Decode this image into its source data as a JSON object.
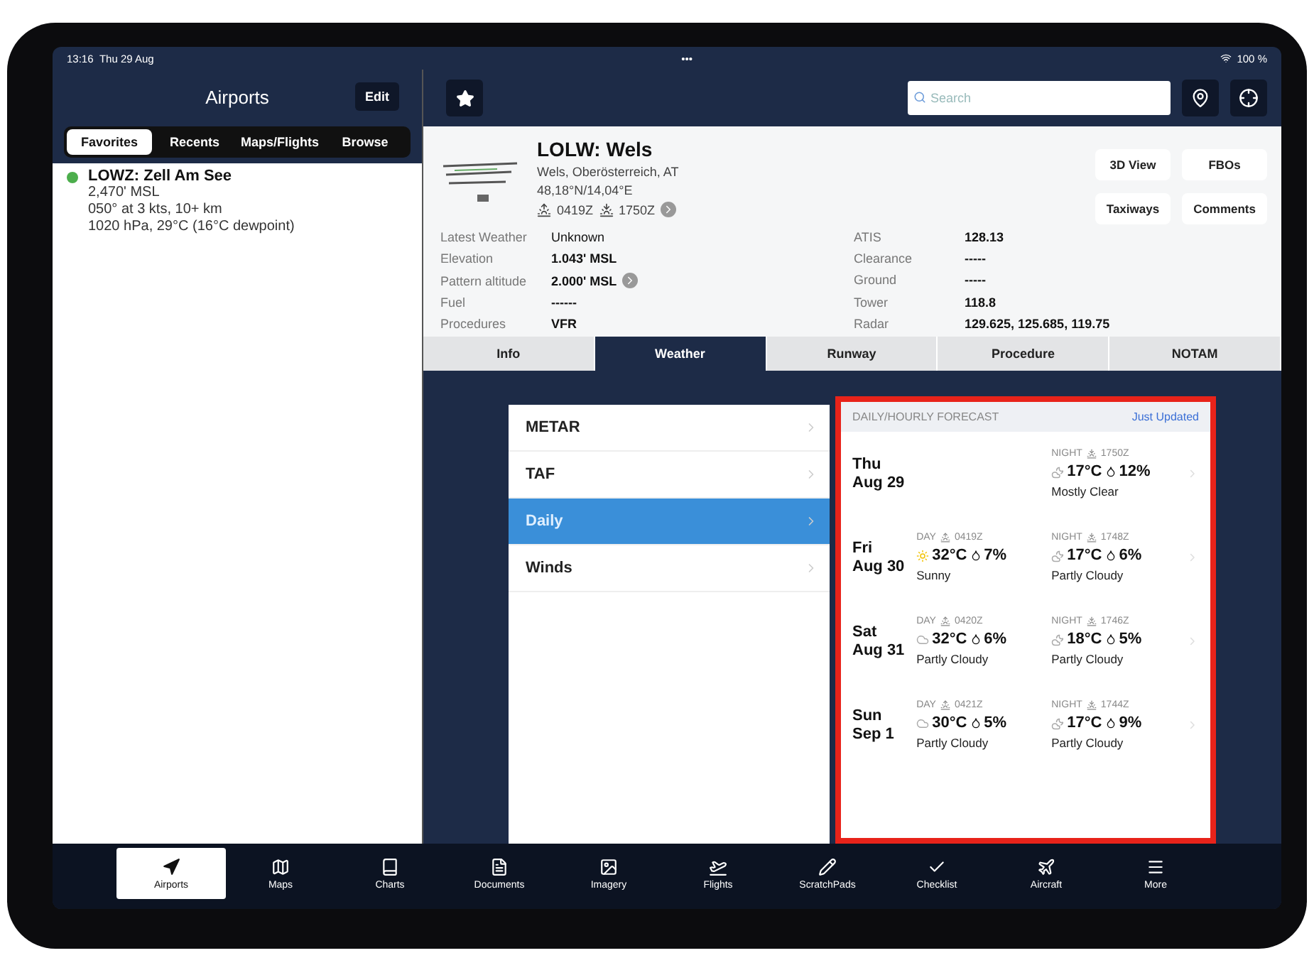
{
  "status_bar": {
    "time": "13:16",
    "date": "Thu 29 Aug",
    "dots": "•••",
    "battery": "100 %"
  },
  "sidebar": {
    "title": "Airports",
    "edit": "Edit",
    "segments": [
      {
        "label": "Favorites",
        "selected": true
      },
      {
        "label": "Recents",
        "selected": false
      },
      {
        "label": "Maps/Flights",
        "selected": false
      },
      {
        "label": "Browse",
        "selected": false
      }
    ],
    "items": [
      {
        "name": "LOWZ: Zell Am See",
        "color": "#4cae4c",
        "lines": [
          "2,470' MSL",
          "050° at 3 kts, 10+ km",
          "1020 hPa, 29°C (16°C dewpoint)"
        ]
      }
    ]
  },
  "toolbar": {
    "search": {
      "placeholder": "Search"
    }
  },
  "airport": {
    "title": "LOLW: Wels",
    "region": "Wels, Oberösterreich, AT",
    "coords": "48,18°N/14,04°E",
    "sunrise": "0419Z",
    "sunset": "1750Z",
    "buttons": [
      "3D View",
      "FBOs",
      "Taxiways",
      "Comments"
    ],
    "left_fields": [
      {
        "label": "Latest Weather",
        "value": "Unknown",
        "bold": false,
        "more": false
      },
      {
        "label": "Elevation",
        "value": "1.043' MSL",
        "bold": true,
        "more": false
      },
      {
        "label": "Pattern altitude",
        "value": "2.000' MSL",
        "bold": true,
        "more": true
      },
      {
        "label": "Fuel",
        "value": "------",
        "bold": true,
        "more": false
      },
      {
        "label": "Procedures",
        "value": "VFR",
        "bold": true,
        "more": false
      }
    ],
    "right_fields": [
      {
        "label": "ATIS",
        "value": "128.13",
        "bold": true,
        "more": false
      },
      {
        "label": "Clearance",
        "value": "-----",
        "bold": true,
        "more": false
      },
      {
        "label": "Ground",
        "value": "-----",
        "bold": true,
        "more": false
      },
      {
        "label": "Tower",
        "value": "118.8",
        "bold": true,
        "more": false
      },
      {
        "label": "Radar",
        "value": "129.625, 125.685, 119.75",
        "bold": true,
        "more": false
      }
    ]
  },
  "tabs": [
    {
      "label": "Info",
      "selected": false
    },
    {
      "label": "Weather",
      "selected": true
    },
    {
      "label": "Runway",
      "selected": false
    },
    {
      "label": "Procedure",
      "selected": false
    },
    {
      "label": "NOTAM",
      "selected": false
    }
  ],
  "weather_menu": [
    {
      "label": "METAR",
      "selected": false
    },
    {
      "label": "TAF",
      "selected": false
    },
    {
      "label": "Daily",
      "selected": true
    },
    {
      "label": "Winds",
      "selected": false
    }
  ],
  "forecast": {
    "title": "DAILY/HOURLY FORECAST",
    "updated": "Just Updated",
    "days": [
      {
        "weekday": "Thu",
        "date": "Aug 29",
        "night": {
          "label": "NIGHT",
          "time": "1750Z",
          "kind": "moon",
          "temp": "17°C",
          "precip": "12%",
          "condition": "Mostly Clear"
        }
      },
      {
        "weekday": "Fri",
        "date": "Aug 30",
        "day": {
          "label": "DAY",
          "time": "0419Z",
          "kind": "sun",
          "temp": "32°C",
          "precip": "7%",
          "condition": "Sunny"
        },
        "night": {
          "label": "NIGHT",
          "time": "1748Z",
          "kind": "moon",
          "temp": "17°C",
          "precip": "6%",
          "condition": "Partly Cloudy"
        }
      },
      {
        "weekday": "Sat",
        "date": "Aug 31",
        "day": {
          "label": "DAY",
          "time": "0420Z",
          "kind": "cloud",
          "temp": "32°C",
          "precip": "6%",
          "condition": "Partly Cloudy"
        },
        "night": {
          "label": "NIGHT",
          "time": "1746Z",
          "kind": "moon",
          "temp": "18°C",
          "precip": "5%",
          "condition": "Partly Cloudy"
        }
      },
      {
        "weekday": "Sun",
        "date": "Sep 1",
        "day": {
          "label": "DAY",
          "time": "0421Z",
          "kind": "cloud",
          "temp": "30°C",
          "precip": "5%",
          "condition": "Partly Cloudy"
        },
        "night": {
          "label": "NIGHT",
          "time": "1744Z",
          "kind": "moon",
          "temp": "17°C",
          "precip": "9%",
          "condition": "Partly Cloudy"
        }
      }
    ]
  },
  "bottom_tabs": [
    {
      "label": "Airports",
      "selected": true
    },
    {
      "label": "Maps",
      "selected": false
    },
    {
      "label": "Charts",
      "selected": false
    },
    {
      "label": "Documents",
      "selected": false
    },
    {
      "label": "Imagery",
      "selected": false
    },
    {
      "label": "Flights",
      "selected": false
    },
    {
      "label": "ScratchPads",
      "selected": false
    },
    {
      "label": "Checklist",
      "selected": false
    },
    {
      "label": "Aircraft",
      "selected": false
    },
    {
      "label": "More",
      "selected": false
    }
  ]
}
